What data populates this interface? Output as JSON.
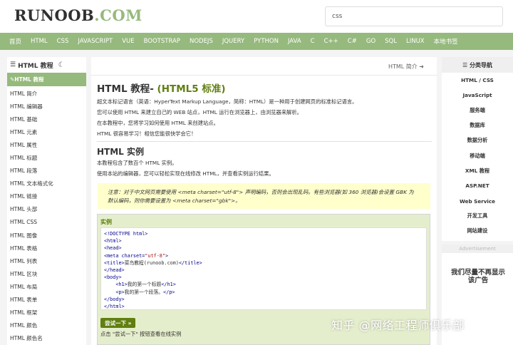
{
  "header": {
    "logo_main": "RUNOOB",
    "logo_suffix": ".COM",
    "search_value": "css"
  },
  "nav": [
    "首页",
    "HTML",
    "CSS",
    "JAVASCRIPT",
    "VUE",
    "BOOTSTRAP",
    "NODEJS",
    "JQUERY",
    "PYTHON",
    "JAVA",
    "C",
    "C++",
    "C#",
    "GO",
    "SQL",
    "LINUX",
    "本地书签"
  ],
  "left": {
    "title": "HTML 教程",
    "icon": "list-icon",
    "moon": "moon-icon",
    "items": [
      "HTML 教程",
      "HTML 简介",
      "HTML 编辑器",
      "HTML 基础",
      "HTML 元素",
      "HTML 属性",
      "HTML 标题",
      "HTML 段落",
      "HTML 文本格式化",
      "HTML 链接",
      "HTML 头部",
      "HTML CSS",
      "HTML 图像",
      "HTML 表格",
      "HTML 列表",
      "HTML 区块",
      "HTML 布局",
      "HTML 表单",
      "HTML 框架",
      "HTML 颜色",
      "HTML 颜色名"
    ]
  },
  "main": {
    "prev": "HTML 简介",
    "title_main": "HTML 教程- ",
    "title_sub": "(HTML5 标准)",
    "intro": [
      "超文本标记语言（英语：HyperText Markup Language，简称：HTML）是一种用于创建网页的标准标记语言。",
      "您可以使用 HTML 来建立自己的 WEB 站点，HTML 运行在浏览器上，由浏览器来解析。",
      "在本教程中，您将学习如何使用 HTML 来创建站点。",
      "HTML 很容易学习！相信您能很快学会它！"
    ],
    "h2": "HTML 实例",
    "ex_intro": [
      "本教程包含了数百个 HTML 实例。",
      "使用本站的编辑器，您可以轻松实现在线修改 HTML，并查看实例运行结果。"
    ],
    "note_line1": "注意：对于中文网页需要使用 <meta charset=\"utf-8\"> 声明编码，否则会出现乱码。有些浏览器(如 360 浏览器)会设置 GBK 为",
    "note_line2": "默认编码，则你需要设置为 <meta charset=\"gbk\">。",
    "example_label": "实例",
    "code": [
      "<!DOCTYPE html>",
      "<html>",
      "<head>",
      "<meta charset=\"utf-8\">",
      "<title>菜鸟教程(runoob.com)</title>",
      "</head>",
      "<body>",
      "    <h1>我的第一个标题</h1>",
      "    <p>我的第一个段落。</p>",
      "</body>",
      "</html>"
    ],
    "try_button": "尝试一下 »",
    "try_note": "点击 \"尝试一下\" 按钮查看在线实例"
  },
  "right": {
    "title": "分类导航",
    "items": [
      "HTML / CSS",
      "JavaScript",
      "服务端",
      "数据库",
      "数据分析",
      "移动端",
      "XML 教程",
      "ASP.NET",
      "Web Service",
      "开发工具",
      "网站建设"
    ]
  },
  "ad": {
    "header": "Advertisement",
    "text": "我们尽量不再显示该广告"
  },
  "watermark": "知乎 @网络工程师俱乐部",
  "colors": {
    "brand": "#96b97d",
    "title_green": "#617f10",
    "note_bg": "#ffffcc",
    "example_bg": "#e5eecc"
  }
}
